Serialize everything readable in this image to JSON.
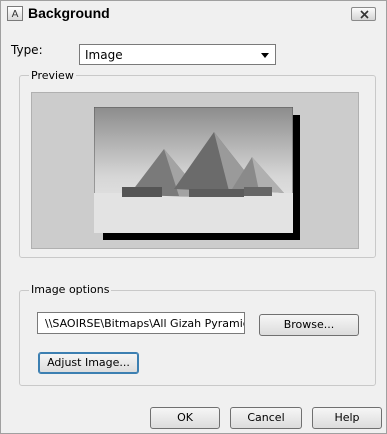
{
  "window": {
    "title": "Background",
    "close_icon": "close-icon"
  },
  "type": {
    "label": "Type:",
    "selected": "Image"
  },
  "preview": {
    "legend": "Preview"
  },
  "image_options": {
    "legend": "Image options",
    "path_value": "\\\\SAOIRSE\\Bitmaps\\All Gizah Pyramids",
    "browse_label": "Browse...",
    "adjust_label": "Adjust Image..."
  },
  "buttons": {
    "ok": "OK",
    "cancel": "Cancel",
    "help": "Help"
  },
  "icons": {
    "app": "app-icon",
    "dropdown": "chevron-down-icon"
  }
}
